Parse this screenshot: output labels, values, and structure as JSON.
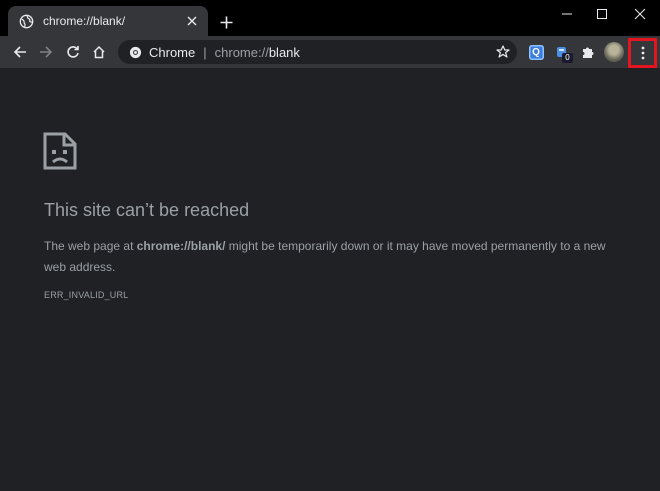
{
  "tab": {
    "title": "chrome://blank/",
    "favicon": "globe-icon",
    "close_icon": "close-icon"
  },
  "newtab_icon": "plus-icon",
  "window_controls": [
    "minimize-icon",
    "maximize-icon",
    "close-icon"
  ],
  "toolbar": {
    "back_icon": "arrow-left-icon",
    "forward_icon": "arrow-right-icon",
    "reload_icon": "reload-icon",
    "home_icon": "home-icon",
    "omnibox": {
      "chip_label": "Chrome",
      "separator": "|",
      "url_scheme": "chrome://",
      "url_host": "blank"
    },
    "bookmark_icon": "star-icon",
    "extensions": [
      {
        "name": "q-extension",
        "label": "Q"
      },
      {
        "name": "badge-extension",
        "badge": "0"
      },
      {
        "name": "puzzle-icon"
      }
    ],
    "avatar": "profile-avatar",
    "menu_icon": "kebab-menu-icon"
  },
  "error_page": {
    "icon": "sad-page-icon",
    "title": "This site can’t be reached",
    "body_prefix": "The web page at ",
    "body_url": "chrome://blank/",
    "body_suffix": " might be temporarily down or it may have moved permanently to a new web address.",
    "error_code": "ERR_INVALID_URL"
  },
  "colors": {
    "titlebar": "#000000",
    "toolbar": "#35363a",
    "page_bg": "#202124",
    "text": "#9aa0a6",
    "highlight": "#e3161f"
  }
}
